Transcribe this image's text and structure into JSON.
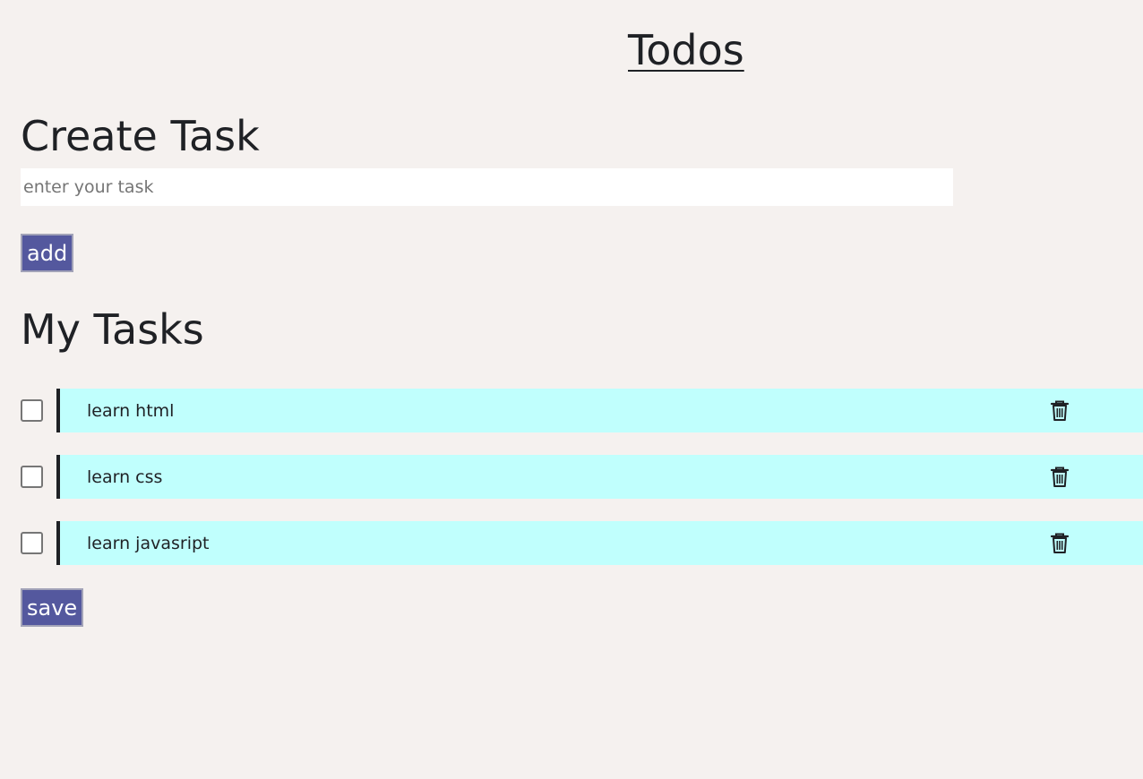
{
  "header": {
    "title": "Todos"
  },
  "create": {
    "heading": "Create Task",
    "input_placeholder": "enter your task",
    "input_value": "",
    "add_label": "add"
  },
  "tasks": {
    "heading": "My Tasks",
    "items": [
      {
        "label": "learn html",
        "checked": false,
        "delete_icon": "trash-icon"
      },
      {
        "label": "learn css",
        "checked": false,
        "delete_icon": "trash-icon"
      },
      {
        "label": "learn javasript",
        "checked": false,
        "delete_icon": "trash-icon"
      }
    ],
    "save_label": "save"
  },
  "colors": {
    "background": "#f5f1ef",
    "task_background": "#c0fffd",
    "button": "#54589e",
    "text": "#1f2125"
  }
}
